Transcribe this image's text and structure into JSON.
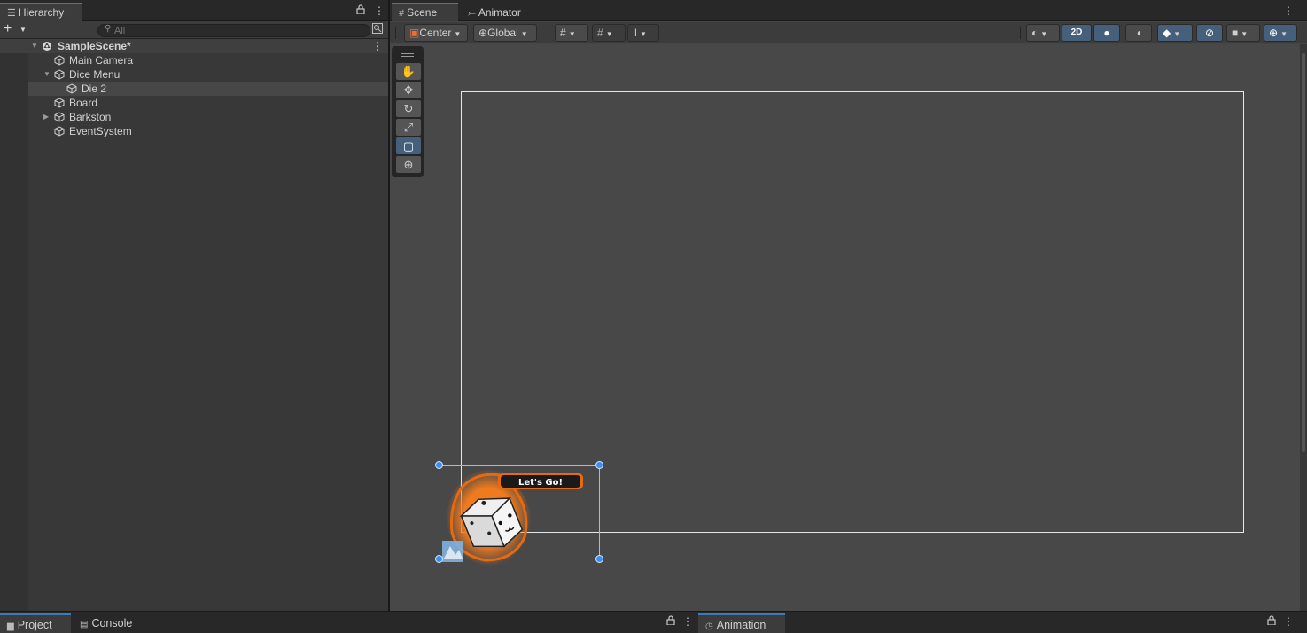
{
  "hierarchy": {
    "tab_label": "Hierarchy",
    "add_label": "+",
    "search_placeholder": "All",
    "items": [
      {
        "label": "SampleScene*"
      },
      {
        "label": "Main Camera"
      },
      {
        "label": "Dice Menu"
      },
      {
        "label": "Die 2"
      },
      {
        "label": "Board"
      },
      {
        "label": "Barkston"
      },
      {
        "label": "EventSystem"
      }
    ]
  },
  "scene": {
    "tabs": [
      {
        "label": "Scene"
      },
      {
        "label": "Animator"
      }
    ],
    "toolbar": {
      "pivot_label": "Center",
      "space_label": "Global",
      "mode_2d_label": "2D"
    },
    "sprite_text": "Let's Go!"
  },
  "bottom": {
    "tabs": [
      {
        "label": "Project"
      },
      {
        "label": "Console"
      },
      {
        "label": "Animation"
      }
    ]
  },
  "colors": {
    "accent": "#3a79bb",
    "active_button": "#46607c",
    "handle": "#3a8ff0",
    "sprite_glow": "#f07a1e"
  }
}
